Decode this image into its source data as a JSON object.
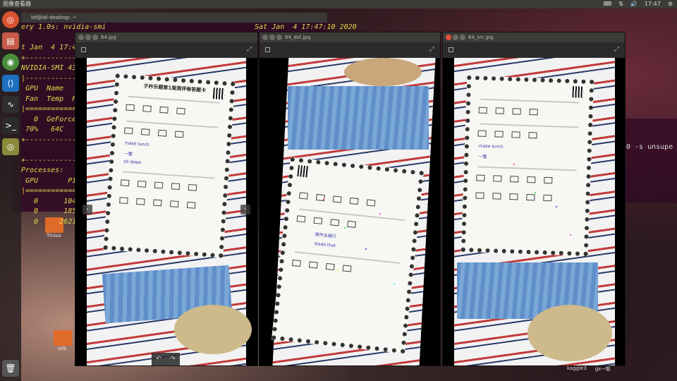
{
  "topbar": {
    "app_title": "图像查看器",
    "time": "17:47"
  },
  "terminal": {
    "title": "ldl@ldl-desktop: ~",
    "lines": [
      "ery 1.0s: nvidia-smi",
      "t Jan  4 17:47",
      "NVIDIA-SMI 436",
      " GPU  Name",
      " Fan  Temp  Per",
      "   0  GeForce G",
      " 70%   64C    P",
      "Processes:",
      " GPU       PID",
      "   0      1041",
      "   0      1858",
      "   0     26216"
    ],
    "timestamp": "Sat Jan  4 17:47:10 2020"
  },
  "right_terminal": {
    "text": "0 -s unsupe"
  },
  "windows": [
    {
      "title": "64.jpg"
    },
    {
      "title": "64_dst.jpg"
    },
    {
      "title": "64_src.jpg"
    }
  ],
  "paper": {
    "title": "子衿乐题第1周测评卷答题卡",
    "handwriting": [
      "make lunch",
      "一整",
      "做作业操行",
      "sit down",
      "stade that"
    ]
  },
  "desktop": {
    "icons": [
      {
        "label": "Tinisa"
      },
      {
        "label": "zxb"
      }
    ],
    "status_items": [
      "kaggle3",
      "gx~哦"
    ]
  }
}
